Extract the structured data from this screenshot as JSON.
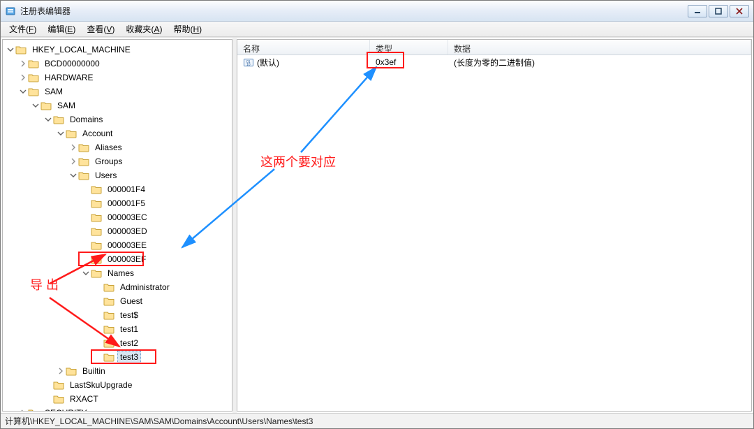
{
  "title": "注册表编辑器",
  "menus": {
    "file": {
      "label": "文件",
      "accel": "F"
    },
    "edit": {
      "label": "编辑",
      "accel": "E"
    },
    "view": {
      "label": "查看",
      "accel": "V"
    },
    "fav": {
      "label": "收藏夹",
      "accel": "A"
    },
    "help": {
      "label": "帮助",
      "accel": "H"
    }
  },
  "tree": {
    "root": {
      "label": "HKEY_LOCAL_MACHINE",
      "expanded": true,
      "children": [
        {
          "label": "BCD00000000",
          "expanded": false,
          "children": [],
          "hasChildren": true
        },
        {
          "label": "HARDWARE",
          "expanded": false,
          "children": [],
          "hasChildren": true
        },
        {
          "label": "SAM",
          "expanded": true,
          "children": [
            {
              "label": "SAM",
              "expanded": true,
              "children": [
                {
                  "label": "Domains",
                  "expanded": true,
                  "children": [
                    {
                      "label": "Account",
                      "expanded": true,
                      "children": [
                        {
                          "label": "Aliases",
                          "hasChildren": true
                        },
                        {
                          "label": "Groups",
                          "hasChildren": true
                        },
                        {
                          "label": "Users",
                          "expanded": true,
                          "children": [
                            {
                              "label": "000001F4"
                            },
                            {
                              "label": "000001F5"
                            },
                            {
                              "label": "000003EC"
                            },
                            {
                              "label": "000003ED"
                            },
                            {
                              "label": "000003EE"
                            },
                            {
                              "label": "000003EF",
                              "boxed": true
                            },
                            {
                              "label": "Names",
                              "expanded": true,
                              "children": [
                                {
                                  "label": "Administrator"
                                },
                                {
                                  "label": "Guest"
                                },
                                {
                                  "label": "test$"
                                },
                                {
                                  "label": "test1"
                                },
                                {
                                  "label": "test2"
                                },
                                {
                                  "label": "test3",
                                  "boxed": true,
                                  "selected": true
                                }
                              ]
                            }
                          ]
                        }
                      ]
                    },
                    {
                      "label": "Builtin",
                      "hasChildren": true
                    }
                  ]
                },
                {
                  "label": "LastSkuUpgrade"
                },
                {
                  "label": "RXACT"
                }
              ]
            }
          ]
        },
        {
          "label": "SECURITY",
          "hasChildren": true
        }
      ]
    }
  },
  "list": {
    "headers": {
      "name": "名称",
      "type": "类型",
      "data": "数据"
    },
    "rows": [
      {
        "name": "(默认)",
        "type": "0x3ef",
        "data": "(长度为零的二进制值)",
        "type_boxed": true
      }
    ]
  },
  "status_path": "计算机\\HKEY_LOCAL_MACHINE\\SAM\\SAM\\Domains\\Account\\Users\\Names\\test3",
  "annotations": {
    "text_export": "导\n出",
    "text_match": "这两个要对应"
  }
}
